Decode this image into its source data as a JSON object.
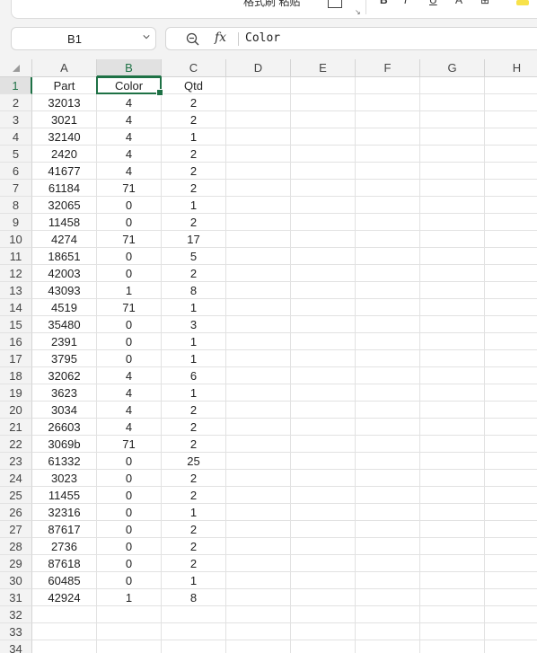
{
  "ribbon": {
    "clipboard_text": "格式刷 粘贴",
    "format_glyphs": [
      "B",
      "I",
      "U",
      "A",
      "⊞"
    ]
  },
  "name_box": {
    "value": "B1"
  },
  "formula_bar": {
    "fx_label": "fx",
    "value": "Color"
  },
  "sheet": {
    "columns": [
      "A",
      "B",
      "C",
      "D",
      "E",
      "F",
      "G",
      "H"
    ],
    "active_column": "B",
    "active_row": 1,
    "rows": [
      [
        "Part",
        "Color",
        "Qtd"
      ],
      [
        "32013",
        "4",
        "2"
      ],
      [
        "3021",
        "4",
        "2"
      ],
      [
        "32140",
        "4",
        "1"
      ],
      [
        "2420",
        "4",
        "2"
      ],
      [
        "41677",
        "4",
        "2"
      ],
      [
        "61184",
        "71",
        "2"
      ],
      [
        "32065",
        "0",
        "1"
      ],
      [
        "11458",
        "0",
        "2"
      ],
      [
        "4274",
        "71",
        "17"
      ],
      [
        "18651",
        "0",
        "5"
      ],
      [
        "42003",
        "0",
        "2"
      ],
      [
        "43093",
        "1",
        "8"
      ],
      [
        "4519",
        "71",
        "1"
      ],
      [
        "35480",
        "0",
        "3"
      ],
      [
        "2391",
        "0",
        "1"
      ],
      [
        "3795",
        "0",
        "1"
      ],
      [
        "32062",
        "4",
        "6"
      ],
      [
        "3623",
        "4",
        "1"
      ],
      [
        "3034",
        "4",
        "2"
      ],
      [
        "26603",
        "4",
        "2"
      ],
      [
        "3069b",
        "71",
        "2"
      ],
      [
        "61332",
        "0",
        "25"
      ],
      [
        "3023",
        "0",
        "2"
      ],
      [
        "11455",
        "0",
        "2"
      ],
      [
        "32316",
        "0",
        "1"
      ],
      [
        "87617",
        "0",
        "2"
      ],
      [
        "2736",
        "0",
        "2"
      ],
      [
        "87618",
        "0",
        "2"
      ],
      [
        "60485",
        "0",
        "1"
      ],
      [
        "42924",
        "1",
        "8"
      ],
      [
        "",
        "",
        ""
      ],
      [
        "",
        "",
        ""
      ],
      [
        "",
        "",
        ""
      ]
    ]
  },
  "colors": {
    "accent": "#1e7145",
    "header_bg": "#f3f3f3",
    "grid_line": "#e2e2e2"
  }
}
